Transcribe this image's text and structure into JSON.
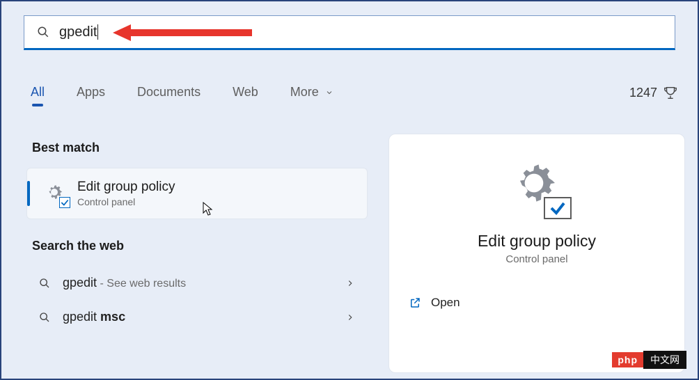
{
  "search": {
    "value": "gpedit"
  },
  "tabs": {
    "all": "All",
    "apps": "Apps",
    "documents": "Documents",
    "web": "Web",
    "more": "More"
  },
  "rewards": {
    "points": "1247"
  },
  "sections": {
    "best_match": "Best match",
    "search_web": "Search the web"
  },
  "best_result": {
    "title": "Edit group policy",
    "subtitle": "Control panel"
  },
  "web_results": [
    {
      "prefix": "gpedit",
      "bold": "",
      "extra": " - See web results"
    },
    {
      "prefix": "gpedit ",
      "bold": "msc",
      "extra": ""
    }
  ],
  "preview": {
    "title": "Edit group policy",
    "subtitle": "Control panel",
    "open": "Open"
  },
  "watermark": {
    "left": "php",
    "right": "中文网"
  }
}
